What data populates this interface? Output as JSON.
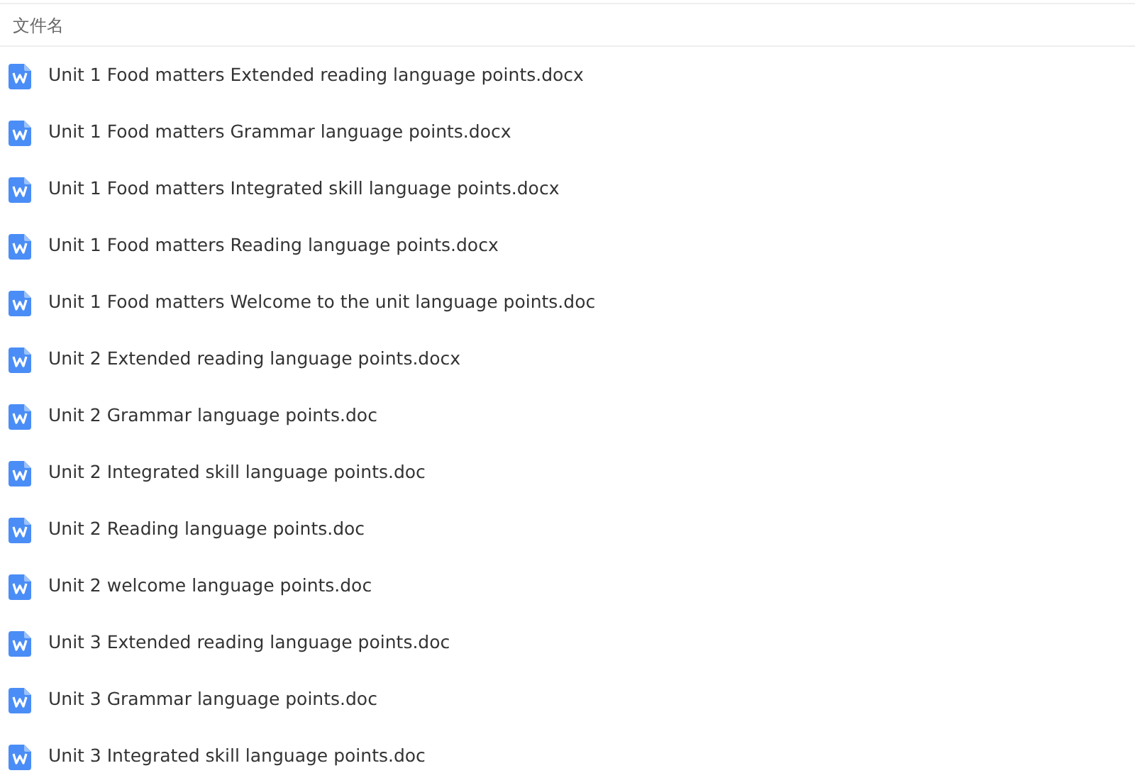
{
  "header": {
    "column_label": "文件名"
  },
  "files": [
    {
      "name": "Unit 1 Food matters Extended reading language points.docx"
    },
    {
      "name": "Unit 1 Food matters Grammar language points.docx"
    },
    {
      "name": "Unit 1 Food matters Integrated skill language points.docx"
    },
    {
      "name": "Unit 1 Food matters Reading language points.docx"
    },
    {
      "name": "Unit 1 Food matters Welcome to the unit language points.doc"
    },
    {
      "name": "Unit 2 Extended reading language points.docx"
    },
    {
      "name": "Unit 2 Grammar language points.doc"
    },
    {
      "name": "Unit 2 Integrated skill language points.doc"
    },
    {
      "name": "Unit 2 Reading language points.doc"
    },
    {
      "name": "Unit 2 welcome language points.doc"
    },
    {
      "name": "Unit 3 Extended reading language points.doc"
    },
    {
      "name": "Unit 3 Grammar language points.doc"
    },
    {
      "name": "Unit 3 Integrated skill language points.doc"
    }
  ]
}
